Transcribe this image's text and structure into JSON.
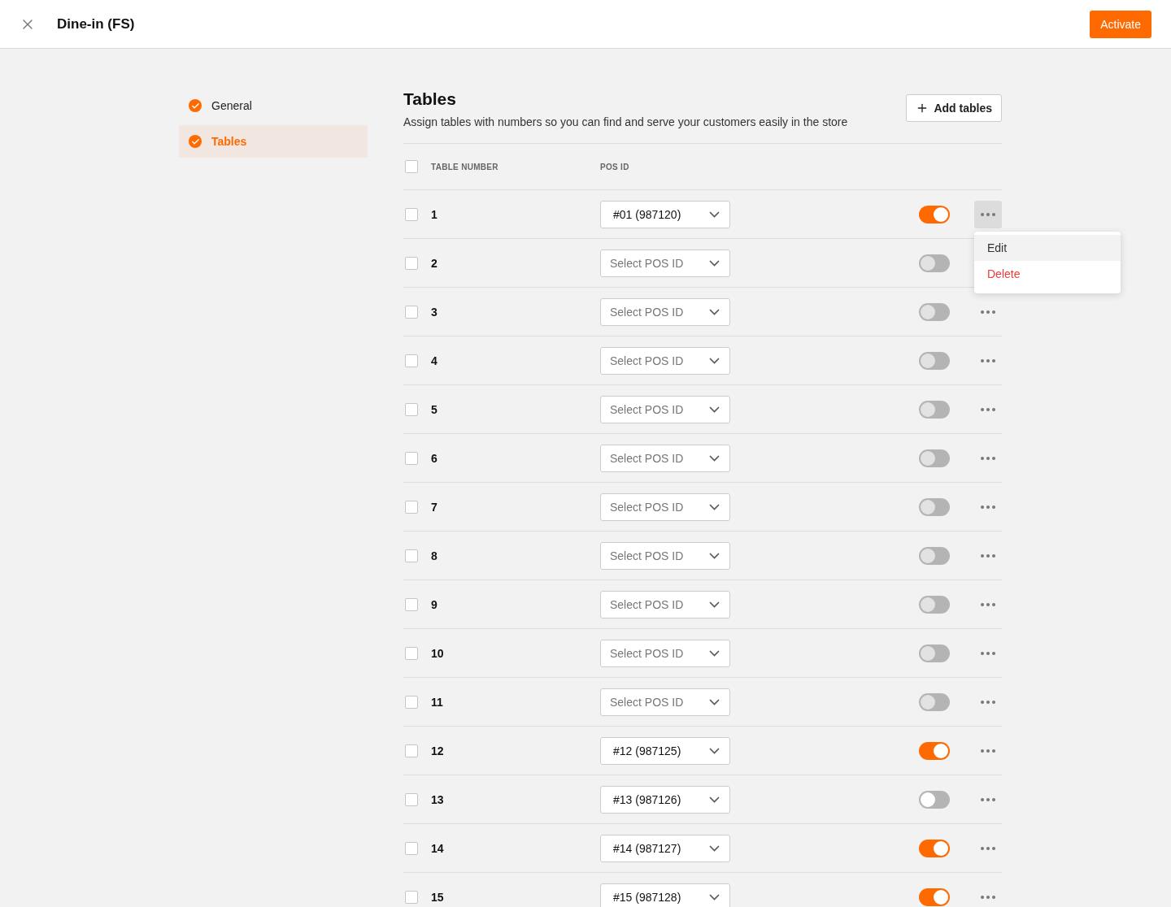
{
  "header": {
    "title": "Dine-in (FS)",
    "action": "Activate"
  },
  "sidebar": {
    "items": [
      {
        "label": "General",
        "completed": true,
        "selected": false
      },
      {
        "label": "Tables",
        "completed": true,
        "selected": true
      }
    ]
  },
  "section": {
    "title": "Tables",
    "description": "Assign tables with numbers so you can find and serve your customers easily in the store",
    "add_button": "Add tables"
  },
  "table": {
    "select_all": false,
    "columns": [
      "TABLE NUMBER",
      "POS ID"
    ],
    "rows": [
      {
        "number": "1",
        "checked": false,
        "pos_id": "#01 (987120)",
        "on": true,
        "disabled": false,
        "menu_open": true,
        "menu": [
          {
            "label": "Edit",
            "kind": "default",
            "highlighted": true
          },
          {
            "label": "Delete",
            "kind": "danger",
            "highlighted": false
          }
        ]
      },
      {
        "number": "2",
        "checked": false,
        "placeholder": "Select POS ID",
        "on": false,
        "disabled": true,
        "menu_open": false
      },
      {
        "number": "3",
        "checked": false,
        "placeholder": "Select POS ID",
        "on": false,
        "disabled": true,
        "menu_open": false
      },
      {
        "number": "4",
        "checked": false,
        "placeholder": "Select POS ID",
        "on": false,
        "disabled": true,
        "menu_open": false
      },
      {
        "number": "5",
        "checked": false,
        "placeholder": "Select POS ID",
        "on": false,
        "disabled": true,
        "menu_open": false
      },
      {
        "number": "6",
        "checked": false,
        "placeholder": "Select POS ID",
        "on": false,
        "disabled": true,
        "menu_open": false
      },
      {
        "number": "7",
        "checked": false,
        "placeholder": "Select POS ID",
        "on": false,
        "disabled": true,
        "menu_open": false
      },
      {
        "number": "8",
        "checked": false,
        "placeholder": "Select POS ID",
        "on": false,
        "disabled": true,
        "menu_open": false
      },
      {
        "number": "9",
        "checked": false,
        "placeholder": "Select POS ID",
        "on": false,
        "disabled": true,
        "menu_open": false
      },
      {
        "number": "10",
        "checked": false,
        "placeholder": "Select POS ID",
        "on": false,
        "disabled": true,
        "menu_open": false
      },
      {
        "number": "11",
        "checked": false,
        "placeholder": "Select POS ID",
        "on": false,
        "disabled": true,
        "menu_open": false
      },
      {
        "number": "12",
        "checked": false,
        "pos_id": "#12 (987125)",
        "on": true,
        "disabled": false,
        "menu_open": false
      },
      {
        "number": "13",
        "checked": false,
        "pos_id": "#13 (987126)",
        "on": false,
        "disabled": false,
        "menu_open": false
      },
      {
        "number": "14",
        "checked": false,
        "pos_id": "#14 (987127)",
        "on": true,
        "disabled": false,
        "menu_open": false
      },
      {
        "number": "15",
        "checked": false,
        "pos_id": "#15 (987128)",
        "on": true,
        "disabled": false,
        "menu_open": false
      }
    ]
  }
}
